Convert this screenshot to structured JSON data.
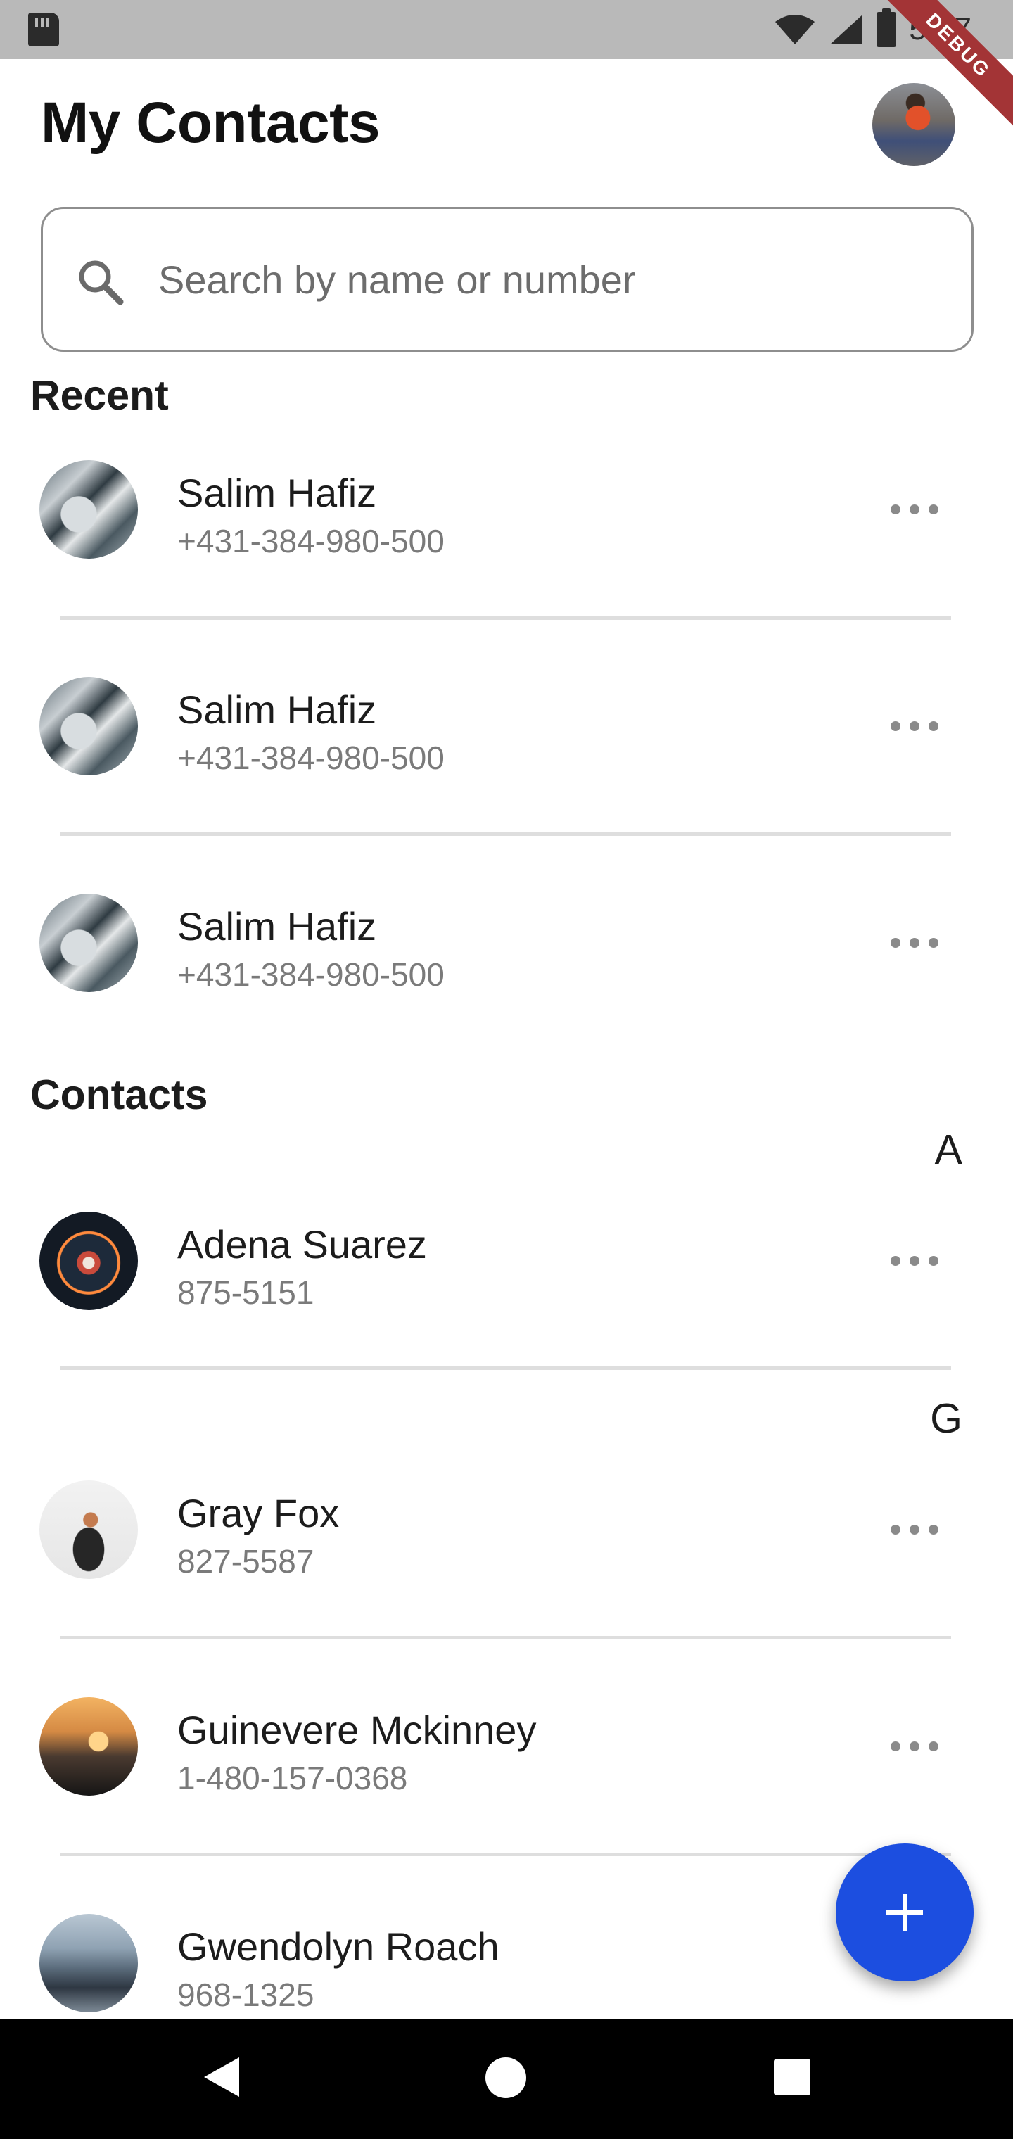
{
  "status_bar": {
    "time": "5:57",
    "icons": [
      "sd-card-icon",
      "wifi-icon",
      "signal-icon",
      "battery-charging-icon"
    ]
  },
  "debug_banner": "DEBUG",
  "header": {
    "title": "My Contacts",
    "profile_icon": "profile-avatar"
  },
  "search": {
    "placeholder": "Search by name or number",
    "value": "",
    "icon": "search-icon"
  },
  "recent": {
    "title": "Recent",
    "items": [
      {
        "name": "Salim Hafiz",
        "phone": "+431-384-980-500"
      },
      {
        "name": "Salim Hafiz",
        "phone": "+431-384-980-500"
      },
      {
        "name": "Salim Hafiz",
        "phone": "+431-384-980-500"
      }
    ]
  },
  "contacts": {
    "title": "Contacts",
    "groups": [
      {
        "letter": "A",
        "items": [
          {
            "name": "Adena Suarez",
            "phone": "875-5151"
          }
        ]
      },
      {
        "letter": "G",
        "items": [
          {
            "name": "Gray Fox",
            "phone": "827-5587"
          },
          {
            "name": "Guinevere Mckinney",
            "phone": "1-480-157-0368"
          },
          {
            "name": "Gwendolyn Roach",
            "phone": "968-1325"
          }
        ]
      }
    ]
  },
  "fab": {
    "icon": "plus-icon",
    "color": "#1c4ee0"
  },
  "nav_bar": {
    "icons": [
      "back-icon",
      "home-icon",
      "recents-icon"
    ]
  },
  "colors": {
    "accent": "#1c4ee0",
    "debug_ribbon": "#a33436",
    "status_bar": "#b9b9b9"
  }
}
